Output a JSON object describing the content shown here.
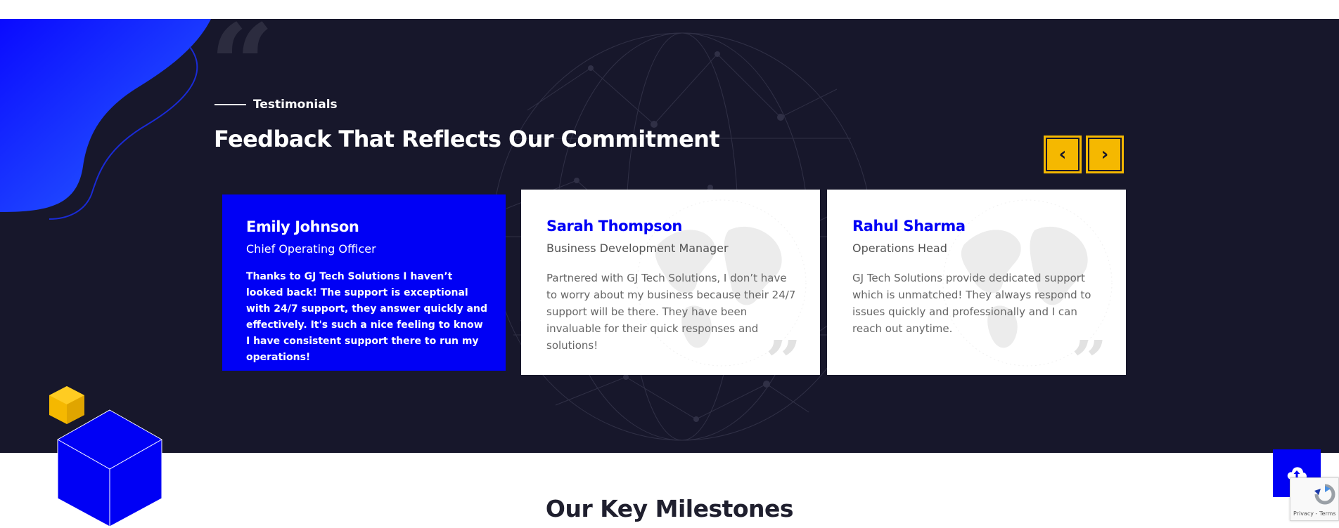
{
  "section": {
    "eyebrow": "Testimonials",
    "title": "Feedback That Reflects Our Commitment"
  },
  "carousel": {
    "prev_icon": "chevron-left-icon",
    "prev_glyph": "‹",
    "next_icon": "chevron-right-icon",
    "next_glyph": "›"
  },
  "testimonials": [
    {
      "name": "Emily Johnson",
      "role": "Chief Operating Officer",
      "text": "Thanks to GJ Tech Solutions I haven’t looked back! The support is exceptional with 24/7 support, they answer quickly and effectively. It's such a nice feeling to know I have consistent support there to run my operations!"
    },
    {
      "name": "Sarah Thompson",
      "role": "Business Development Manager",
      "text": "Partnered with GJ Tech Solutions, I don’t have to worry about my business because their 24/7 support will be there. They have been invaluable for their quick responses and solutions!"
    },
    {
      "name": "Rahul Sharma",
      "role": "Operations Head",
      "text": "GJ Tech Solutions provide dedicated support which is unmatched! They always respond to issues quickly and professionally and I can reach out anytime."
    }
  ],
  "milestones": {
    "title": "Our Key Milestones"
  },
  "scroll_top": {
    "icon": "cloud-upload-icon"
  },
  "recaptcha": {
    "links": "Privacy - Terms"
  },
  "colors": {
    "accent_blue": "#0000f5",
    "dark_bg": "#17172b",
    "yellow": "#f5b800"
  }
}
